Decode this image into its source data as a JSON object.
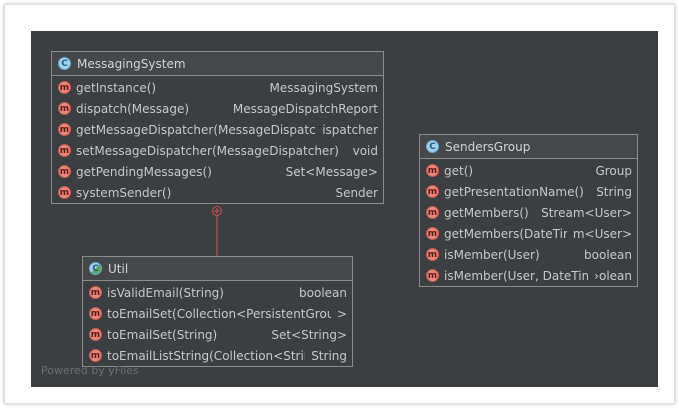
{
  "watermark": "Powered by yFiles",
  "colors": {
    "canvas": "#3c3f41",
    "border": "#8c8c8c",
    "connector": "#c75450",
    "method_icon": "#e9857b",
    "class_icon": "#9fd1f0"
  },
  "classes": {
    "messaging_system": {
      "name": "MessagingSystem",
      "icon": "class-icon",
      "members": [
        {
          "name": "getInstance()",
          "type": "MessagingSystem"
        },
        {
          "name": "dispatch(Message)",
          "type": "MessageDispatchReport"
        },
        {
          "name": "getMessageDispatcher(MessageDispatcher)",
          "type": "ispatcher"
        },
        {
          "name": "setMessageDispatcher(MessageDispatcher)",
          "type": "void"
        },
        {
          "name": "getPendingMessages()",
          "type": "Set<Message>"
        },
        {
          "name": "systemSender()",
          "type": "Sender"
        }
      ]
    },
    "senders_group": {
      "name": "SendersGroup",
      "icon": "class-icon",
      "members": [
        {
          "name": "get()",
          "type": "Group"
        },
        {
          "name": "getPresentationName()",
          "type": "String"
        },
        {
          "name": "getMembers()",
          "type": "Stream<User>"
        },
        {
          "name": "getMembers(DateTime)",
          "type": "m<User>"
        },
        {
          "name": "isMember(User)",
          "type": "boolean"
        },
        {
          "name": "isMember(User, DateTime)",
          "type": "›olean"
        }
      ]
    },
    "util": {
      "name": "Util",
      "icon": "static-class-icon",
      "members": [
        {
          "name": "isValidEmail(String)",
          "type": "boolean"
        },
        {
          "name": "toEmailSet(Collection<PersistentGroup>)",
          "type": ">"
        },
        {
          "name": "toEmailSet(String)",
          "type": "Set<String>"
        },
        {
          "name": "toEmailListString(Collection<String>)",
          "type": "String"
        }
      ]
    }
  },
  "method_icon_letter": "m",
  "class_icon_letter": "C"
}
